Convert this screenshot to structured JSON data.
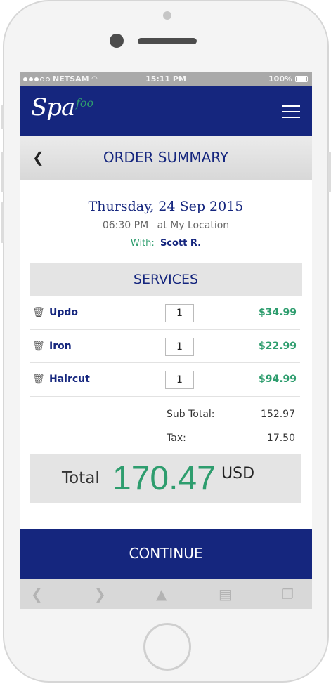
{
  "status_bar": {
    "carrier": "NETSAM",
    "time": "15:11 PM",
    "battery": "100%"
  },
  "brand": {
    "logo_main": "Spa",
    "logo_sup": "foo"
  },
  "header": {
    "title": "ORDER SUMMARY"
  },
  "appointment": {
    "date": "Thursday, 24 Sep 2015",
    "time": "06:30 PM",
    "location": "at My Location",
    "with_label": "With:",
    "with_name": "Scott R."
  },
  "services": {
    "title": "SERVICES",
    "items": [
      {
        "name": "Updo",
        "qty": "1",
        "price": "$34.99"
      },
      {
        "name": "Iron",
        "qty": "1",
        "price": "$22.99"
      },
      {
        "name": "Haircut",
        "qty": "1",
        "price": "$94.99"
      }
    ]
  },
  "totals": {
    "subtotal_label": "Sub Total:",
    "subtotal_value": "152.97",
    "tax_label": "Tax:",
    "tax_value": "17.50",
    "total_label": "Total",
    "total_value": "170.47",
    "currency": "USD"
  },
  "actions": {
    "continue_label": "CONTINUE"
  },
  "colors": {
    "brand_blue": "#15267e",
    "accent_green": "#2e9d6e"
  }
}
